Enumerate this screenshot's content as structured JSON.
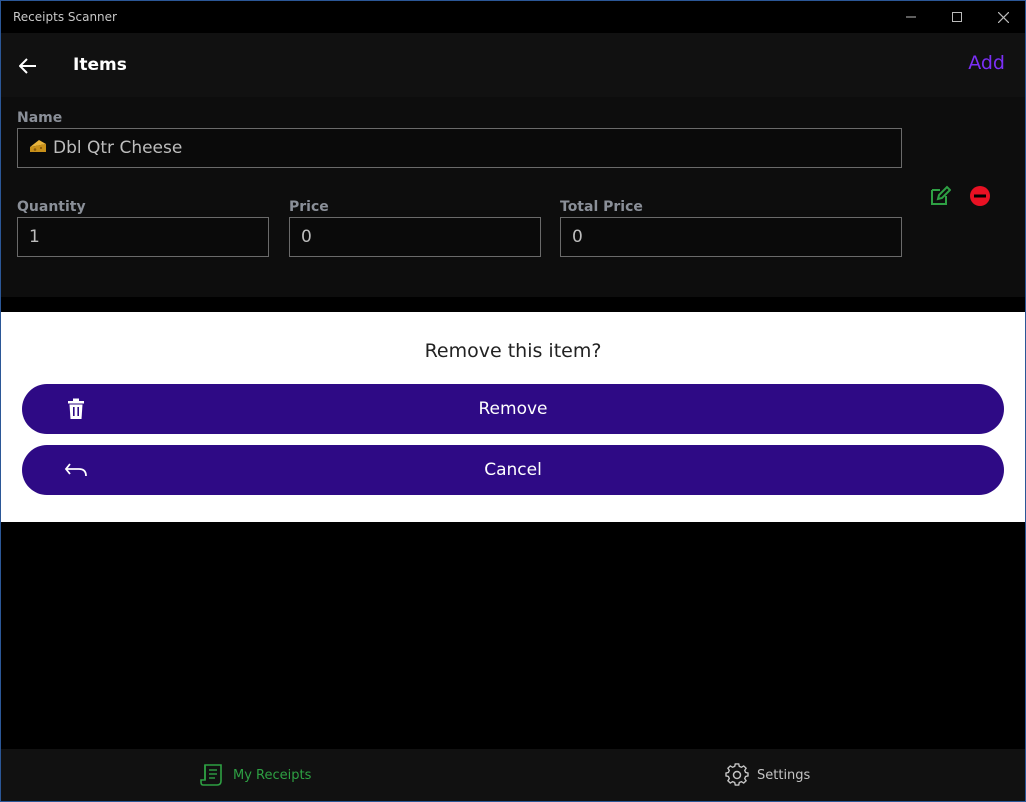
{
  "window": {
    "title": "Receipts Scanner"
  },
  "header": {
    "title": "Items",
    "add_label": "Add"
  },
  "item": {
    "name_label": "Name",
    "name_value": "Dbl Qtr Cheese",
    "name_icon": "cheese-icon",
    "quantity_label": "Quantity",
    "quantity_value": "1",
    "price_label": "Price",
    "price_value": "0",
    "total_label": "Total Price",
    "total_value": "0"
  },
  "dialog": {
    "title": "Remove this item?",
    "remove_label": "Remove",
    "cancel_label": "Cancel"
  },
  "nav": {
    "receipts_label": "My Receipts",
    "settings_label": "Settings"
  },
  "colors": {
    "accent": "#7b2ff7",
    "dialog_button": "#2e0a85",
    "edit_green": "#2ea043",
    "remove_red": "#e81123",
    "active_nav": "#2ea043"
  }
}
